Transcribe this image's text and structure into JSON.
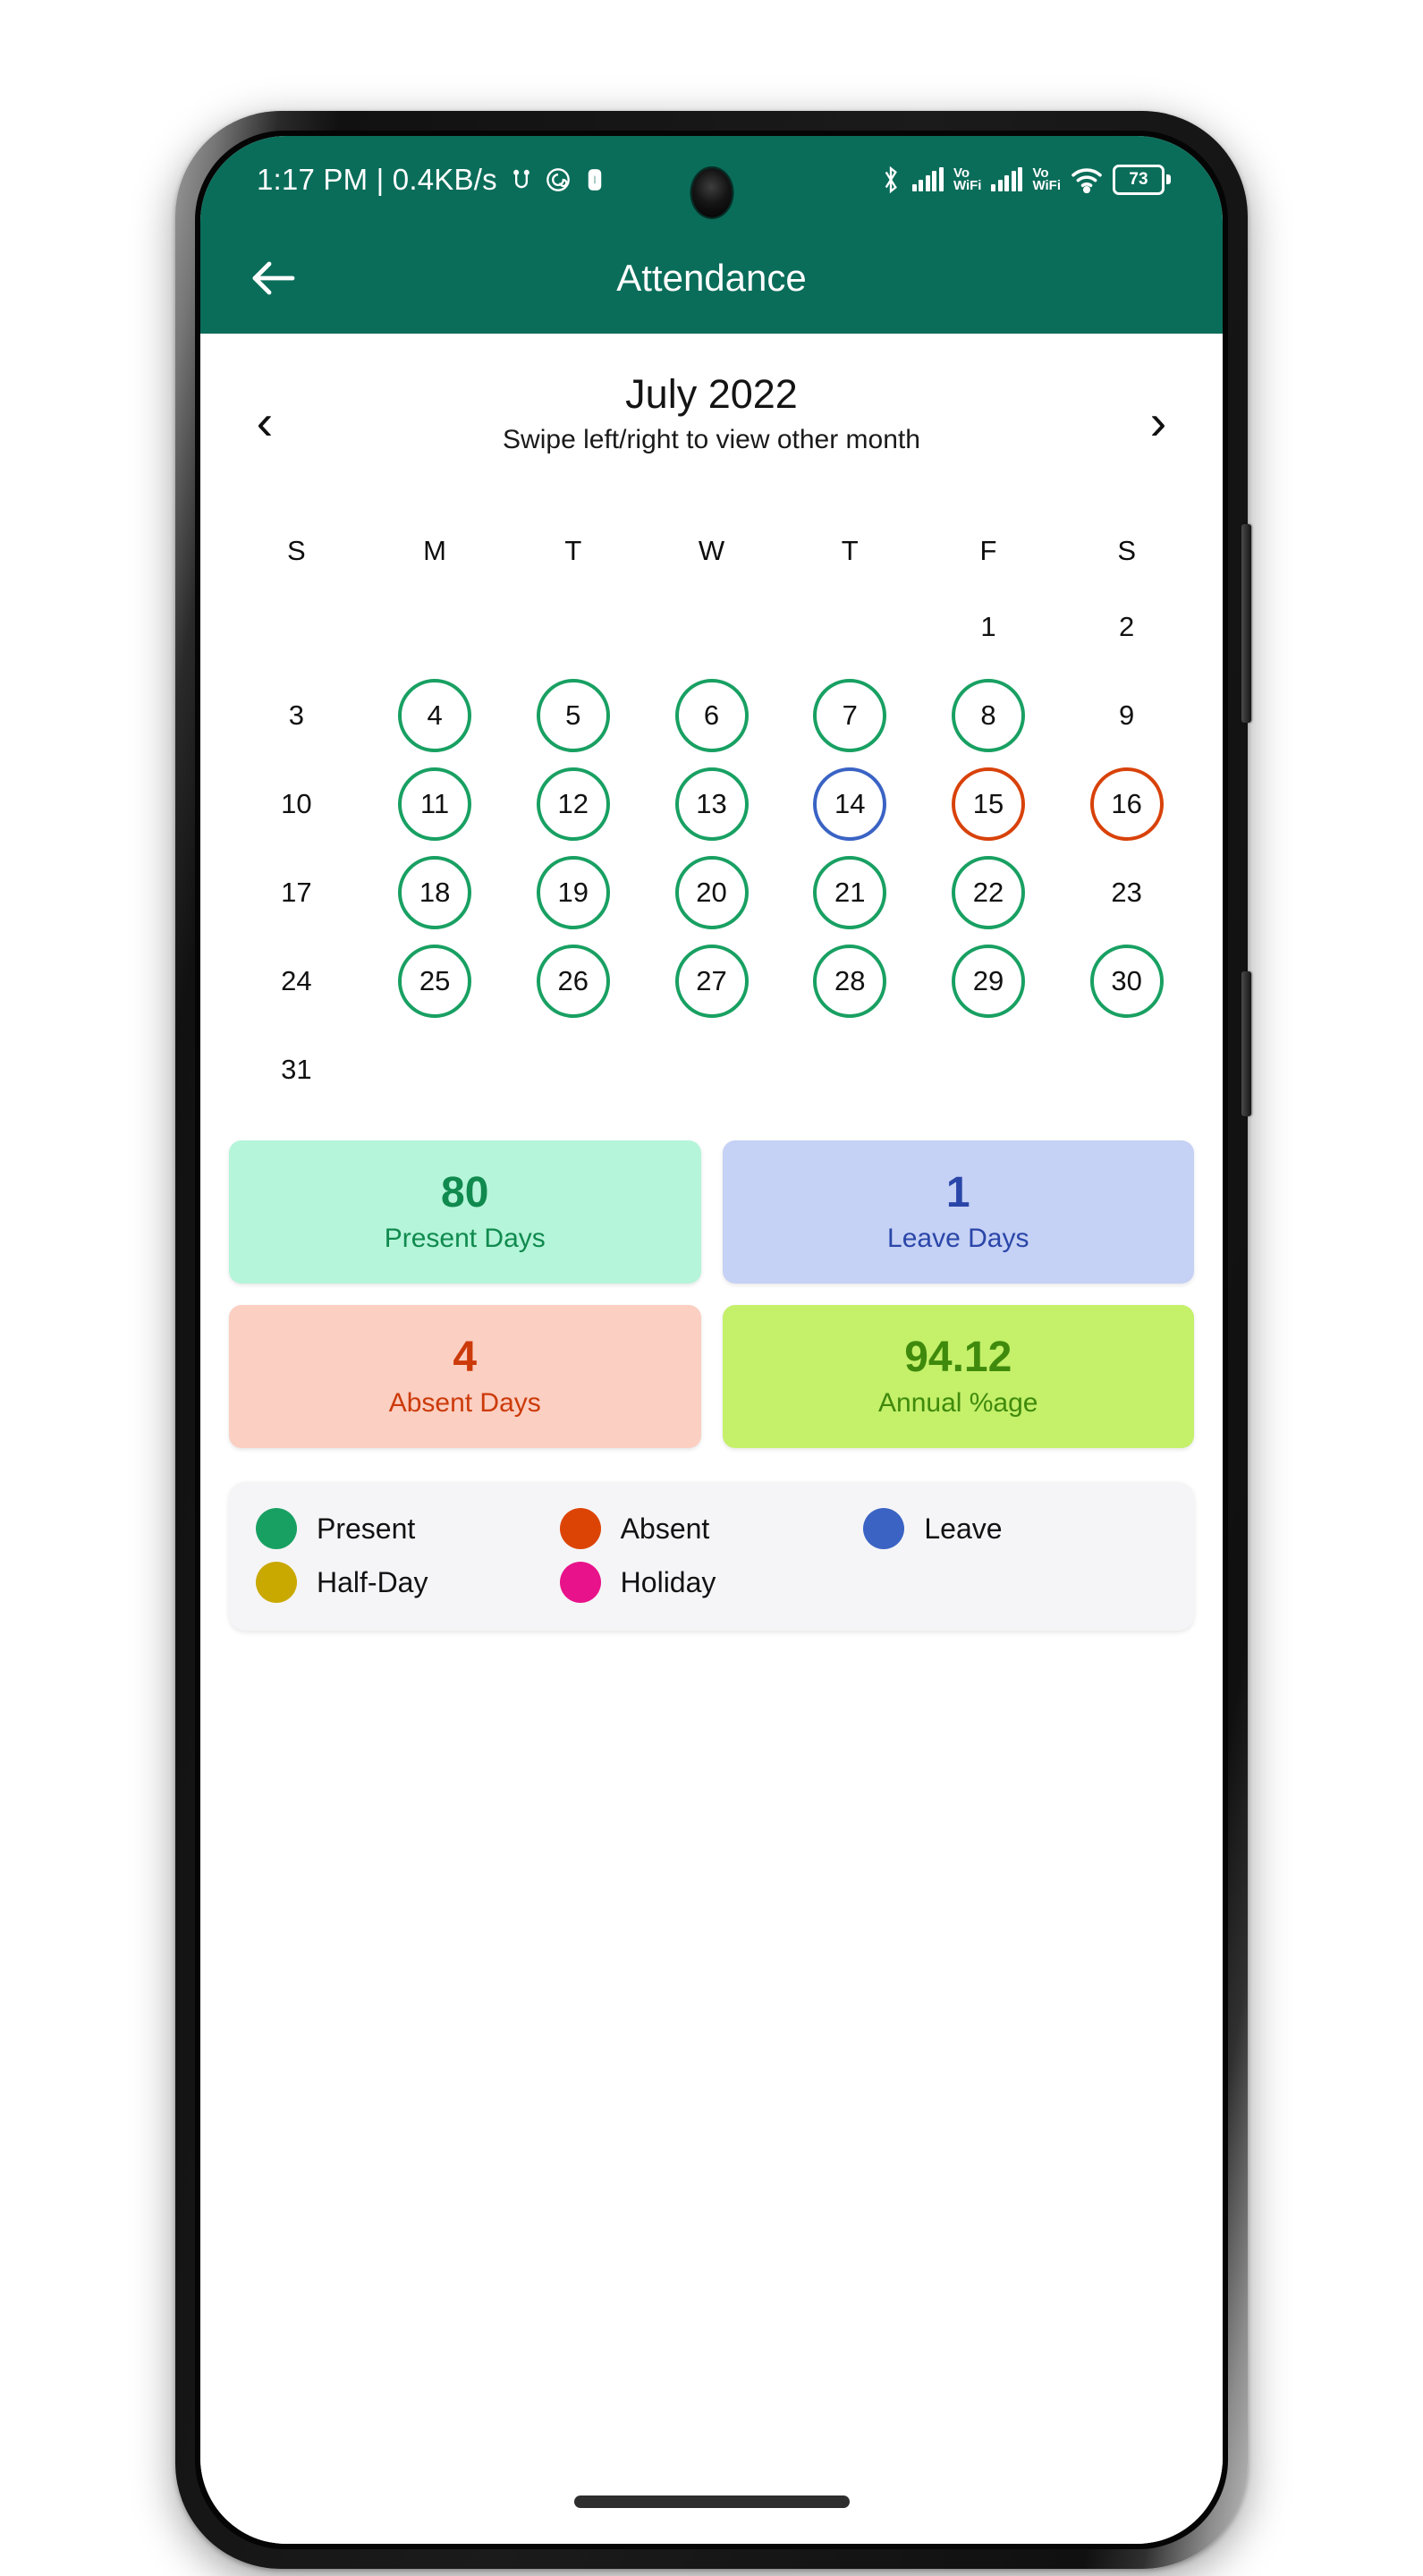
{
  "status_bar": {
    "time_and_net": "1:17 PM | 0.4KB/s",
    "icons": [
      "usb-debug-icon",
      "spiral-app-icon",
      "vpn-key-icon"
    ],
    "bluetooth_icon": "bluetooth-icon",
    "sim1_label": "Vo\nWiFi",
    "sim1_vo": "Vo",
    "sim1_wifi": "WiFi",
    "sim2_vo": "Vo",
    "sim2_wifi": "WiFi",
    "wifi_icon": "wifi-icon",
    "battery_level": "73"
  },
  "app_bar": {
    "back_icon": "arrow-left-icon",
    "title": "Attendance"
  },
  "month_nav": {
    "prev_icon": "‹",
    "next_icon": "›",
    "title": "July 2022",
    "subtitle": "Swipe left/right to view other month"
  },
  "calendar": {
    "weekday_headers": [
      "S",
      "M",
      "T",
      "W",
      "T",
      "F",
      "S"
    ],
    "weeks": [
      [
        {
          "day": "",
          "status": "none"
        },
        {
          "day": "",
          "status": "none"
        },
        {
          "day": "",
          "status": "none"
        },
        {
          "day": "",
          "status": "none"
        },
        {
          "day": "",
          "status": "none"
        },
        {
          "day": "1",
          "status": "none"
        },
        {
          "day": "2",
          "status": "none"
        }
      ],
      [
        {
          "day": "3",
          "status": "none"
        },
        {
          "day": "4",
          "status": "present"
        },
        {
          "day": "5",
          "status": "present"
        },
        {
          "day": "6",
          "status": "present"
        },
        {
          "day": "7",
          "status": "present"
        },
        {
          "day": "8",
          "status": "present"
        },
        {
          "day": "9",
          "status": "none"
        }
      ],
      [
        {
          "day": "10",
          "status": "none"
        },
        {
          "day": "11",
          "status": "present"
        },
        {
          "day": "12",
          "status": "present"
        },
        {
          "day": "13",
          "status": "present"
        },
        {
          "day": "14",
          "status": "leave"
        },
        {
          "day": "15",
          "status": "absent"
        },
        {
          "day": "16",
          "status": "absent"
        }
      ],
      [
        {
          "day": "17",
          "status": "none"
        },
        {
          "day": "18",
          "status": "present"
        },
        {
          "day": "19",
          "status": "present"
        },
        {
          "day": "20",
          "status": "present"
        },
        {
          "day": "21",
          "status": "present"
        },
        {
          "day": "22",
          "status": "present"
        },
        {
          "day": "23",
          "status": "none"
        }
      ],
      [
        {
          "day": "24",
          "status": "none"
        },
        {
          "day": "25",
          "status": "present"
        },
        {
          "day": "26",
          "status": "present"
        },
        {
          "day": "27",
          "status": "present"
        },
        {
          "day": "28",
          "status": "present"
        },
        {
          "day": "29",
          "status": "present"
        },
        {
          "day": "30",
          "status": "present"
        }
      ],
      [
        {
          "day": "31",
          "status": "none"
        },
        {
          "day": "",
          "status": "none"
        },
        {
          "day": "",
          "status": "none"
        },
        {
          "day": "",
          "status": "none"
        },
        {
          "day": "",
          "status": "none"
        },
        {
          "day": "",
          "status": "none"
        },
        {
          "day": "",
          "status": "none"
        }
      ]
    ]
  },
  "stats": [
    {
      "value": "80",
      "label": "Present Days",
      "bg": "#b5f5da",
      "fg": "#108a4e"
    },
    {
      "value": "1",
      "label": "Leave Days",
      "bg": "#c5d1f5",
      "fg": "#2a46a8"
    },
    {
      "value": "4",
      "label": "Absent Days",
      "bg": "#fbcfc1",
      "fg": "#cc3a0a"
    },
    {
      "value": "94.12",
      "label": "Annual %age",
      "bg": "#c4f06a",
      "fg": "#3f8a0c"
    }
  ],
  "legend": {
    "row1": [
      {
        "label": "Present",
        "color": "#18a062"
      },
      {
        "label": "Absent",
        "color": "#dc4406"
      },
      {
        "label": "Leave",
        "color": "#3a63c4"
      }
    ],
    "row2": [
      {
        "label": "Half-Day",
        "color": "#c9a800"
      },
      {
        "label": "Holiday",
        "color": "#e8128a"
      },
      {
        "label": "",
        "color": "transparent"
      }
    ]
  },
  "theme": {
    "header_green": "#0a6d5a",
    "present_green": "#18a062",
    "absent_red": "#dc4406",
    "leave_blue": "#3a63c4",
    "halfday_yellow": "#c9a800",
    "holiday_pink": "#e8128a"
  }
}
